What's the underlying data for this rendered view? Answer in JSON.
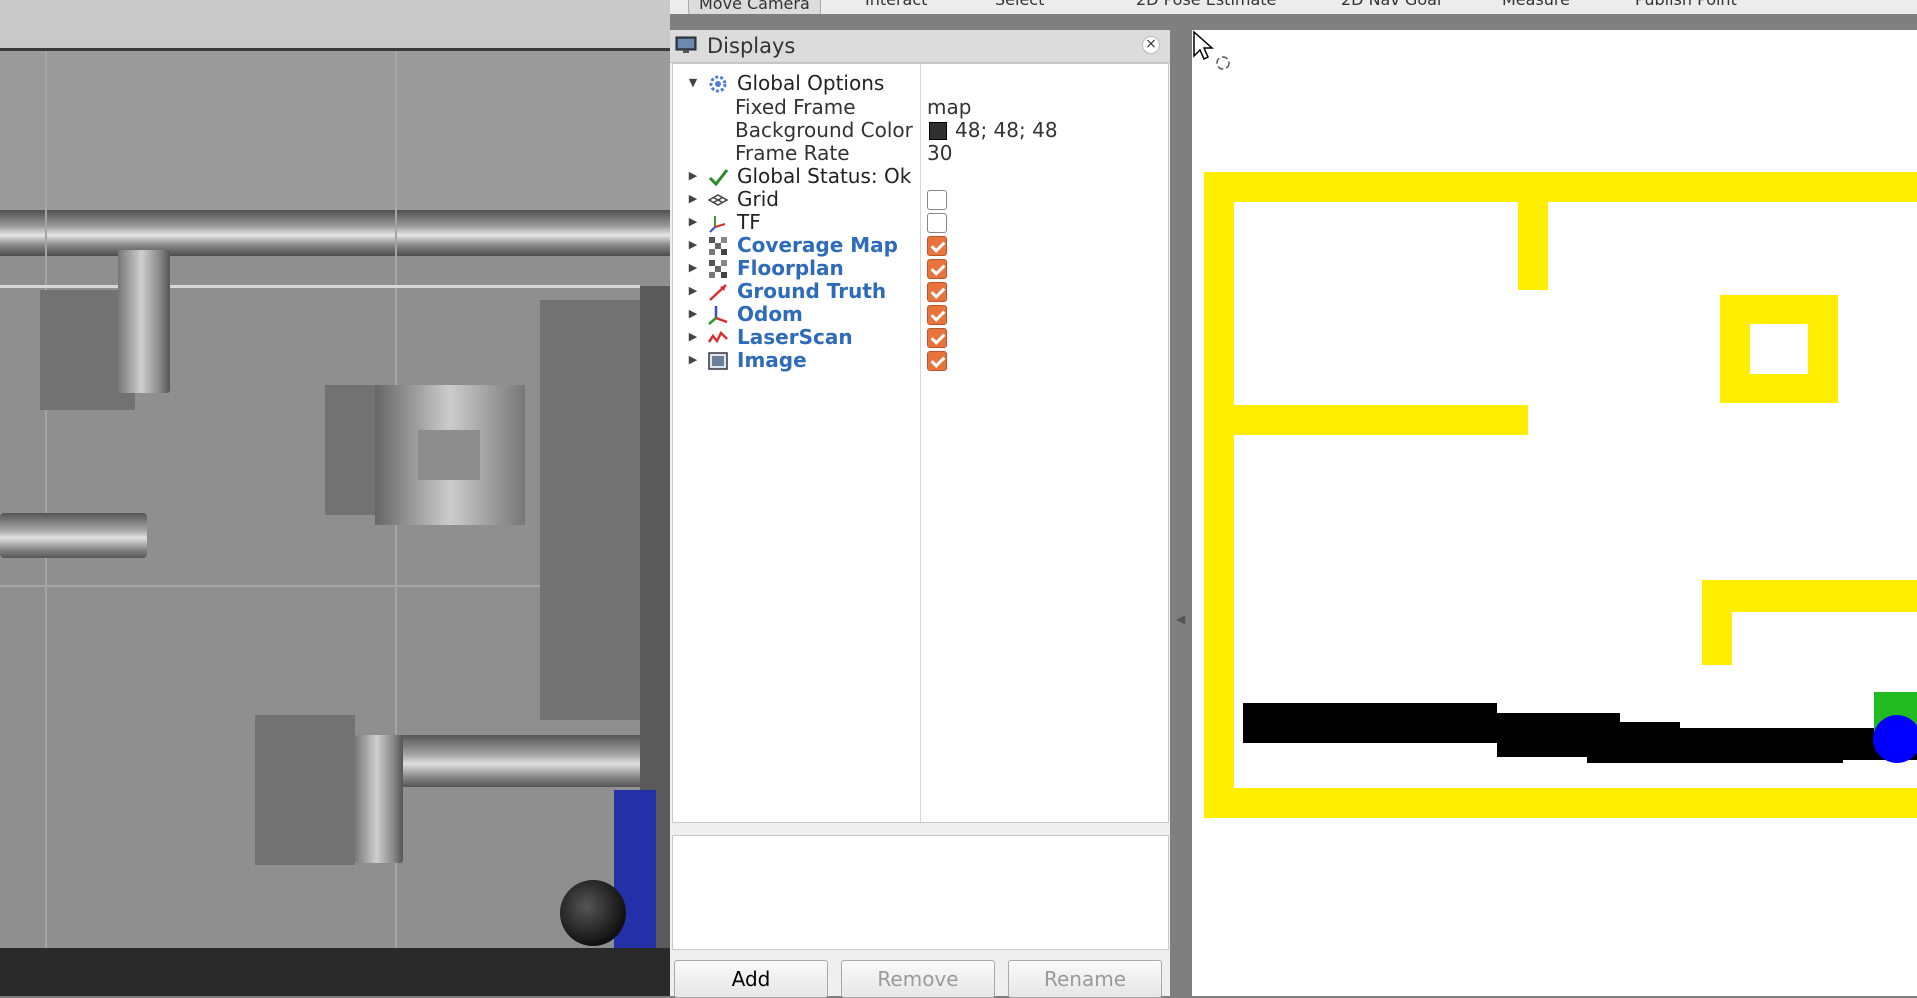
{
  "toolbar": {
    "tools": [
      "Move Camera",
      "Interact",
      "Select",
      "2D Pose Estimate",
      "2D Nav Goal",
      "Measure",
      "Publish Point"
    ]
  },
  "displays_panel": {
    "title": "Displays",
    "global_options": {
      "label": "Global Options",
      "properties": [
        {
          "name": "Fixed Frame",
          "value": "map"
        },
        {
          "name": "Background Color",
          "value": "48; 48; 48",
          "swatch": "#303030"
        },
        {
          "name": "Frame Rate",
          "value": "30"
        }
      ]
    },
    "global_status": "Global Status: Ok",
    "displays": [
      {
        "label": "Grid",
        "checked": false,
        "icon": "grid-icon"
      },
      {
        "label": "TF",
        "checked": false,
        "icon": "tf-axes-icon"
      },
      {
        "label": "Coverage Map",
        "checked": true,
        "icon": "map-icon"
      },
      {
        "label": "Floorplan",
        "checked": true,
        "icon": "map-icon"
      },
      {
        "label": "Ground Truth",
        "checked": true,
        "icon": "odometry-arrow-icon"
      },
      {
        "label": "Odom",
        "checked": true,
        "icon": "axes-icon"
      },
      {
        "label": "LaserScan",
        "checked": true,
        "icon": "laserscan-icon"
      },
      {
        "label": "Image",
        "checked": true,
        "icon": "image-icon"
      }
    ],
    "buttons": {
      "add": "Add",
      "remove": "Remove",
      "rename": "Rename"
    }
  },
  "colors": {
    "checkbox_checked": "#e8743b",
    "display_label": "#2e6bb8",
    "floorplan_wall": "#ffee00",
    "coverage": "#000000",
    "robot": "#0000ff",
    "background_color_swatch": "#303030"
  }
}
